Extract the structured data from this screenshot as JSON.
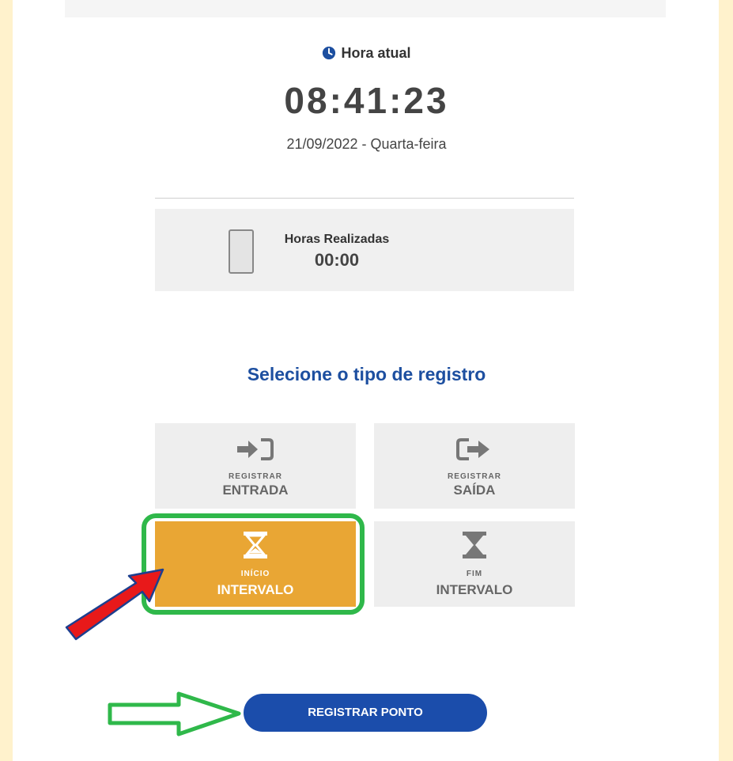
{
  "clock": {
    "label": "Hora atual",
    "time": "08:41:23",
    "date": "21/09/2022 - Quarta-feira",
    "icon": "clock-icon"
  },
  "hours": {
    "label": "Horas Realizadas",
    "value": "00:00",
    "icon": "phone-icon"
  },
  "select_title": "Selecione o tipo de registro",
  "options": {
    "entrada": {
      "small": "REGISTRAR",
      "big": "ENTRADA",
      "icon": "sign-in-icon"
    },
    "saida": {
      "small": "REGISTRAR",
      "big": "SAÍDA",
      "icon": "sign-out-icon"
    },
    "inicio": {
      "small": "INÍCIO",
      "big": "INTERVALO",
      "icon": "hourglass-start-icon",
      "selected": true
    },
    "fim": {
      "small": "FIM",
      "big": "INTERVALO",
      "icon": "hourglass-end-icon"
    }
  },
  "register_button": "REGISTRAR PONTO",
  "colors": {
    "background": "#fff2cc",
    "accent_blue": "#1b4dab",
    "selected_orange": "#e9a634",
    "highlight_green": "#2fb84a",
    "arrow_red": "#e8191a"
  }
}
